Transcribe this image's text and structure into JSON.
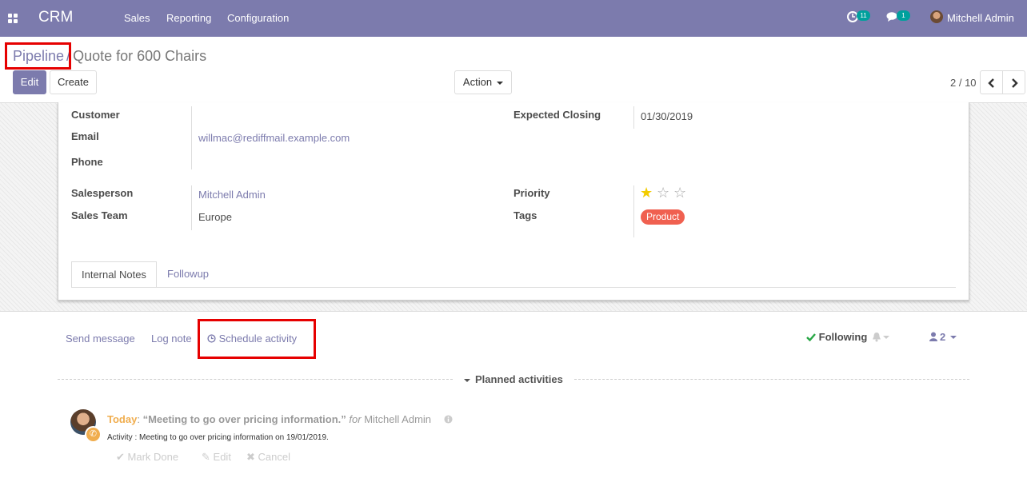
{
  "navbar": {
    "app_name": "CRM",
    "menus": [
      "Sales",
      "Reporting",
      "Configuration"
    ],
    "activity_count": "11",
    "message_count": "1",
    "user_name": "Mitchell Admin"
  },
  "breadcrumb": {
    "parent": "Pipeline",
    "separator": "/",
    "current": "Quote for 600 Chairs"
  },
  "buttons": {
    "edit": "Edit",
    "create": "Create",
    "action": "Action"
  },
  "pager": {
    "text": "2 / 10"
  },
  "form": {
    "customer_label": "Customer",
    "email_label": "Email",
    "email_value": "willmac@rediffmail.example.com",
    "phone_label": "Phone",
    "expected_closing_label": "Expected Closing",
    "expected_closing_value": "01/30/2019",
    "salesperson_label": "Salesperson",
    "salesperson_value": "Mitchell Admin",
    "sales_team_label": "Sales Team",
    "sales_team_value": "Europe",
    "priority_label": "Priority",
    "priority_value": 1,
    "priority_max": 3,
    "tags_label": "Tags",
    "tag_value": "Product",
    "tag_color": "#f06050"
  },
  "tabs": [
    "Internal Notes",
    "Followup"
  ],
  "chatter": {
    "send_message": "Send message",
    "log_note": "Log note",
    "schedule_activity": "Schedule activity",
    "following": "Following",
    "followers_count": "2",
    "planned_activities": "Planned activities"
  },
  "activity": {
    "when": "Today",
    "summary": "“Meeting to go over pricing information.”",
    "for_text": "for",
    "assignee": "Mitchell Admin",
    "note": "Activity : Meeting to go over pricing information on 19/01/2019.",
    "mark_done": "Mark Done",
    "edit": "Edit",
    "cancel": "Cancel"
  },
  "colors": {
    "brand": "#7c7bad",
    "highlight": "#e60000",
    "star": "#f3cc00",
    "today": "#f0ad4e",
    "following": "#28a745"
  }
}
